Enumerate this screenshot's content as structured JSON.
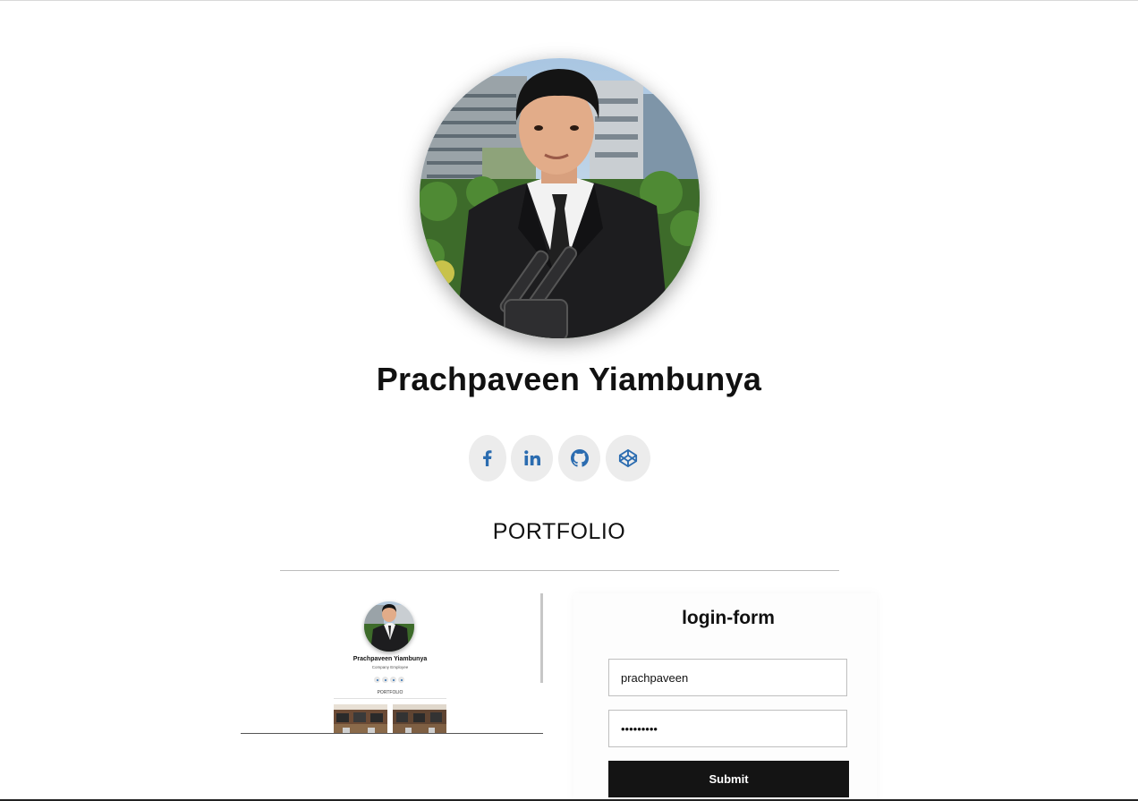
{
  "profile": {
    "name": "Prachpaveen Yiambunya",
    "photo_alt": "profile photo"
  },
  "socials": [
    {
      "network": "facebook",
      "icon": "facebook-icon"
    },
    {
      "network": "linkedin",
      "icon": "linkedin-icon"
    },
    {
      "network": "github",
      "icon": "github-icon"
    },
    {
      "network": "codepen",
      "icon": "codepen-icon"
    }
  ],
  "colors": {
    "icon_accent": "#2b6cb0",
    "social_bg": "#ececec",
    "button_bg": "#141414"
  },
  "section": {
    "title": "PORTFOLIO"
  },
  "preview": {
    "name": "Prachpaveen Yiambunya",
    "subtitle": "Company Employee",
    "section_title": "PORTFOLIO"
  },
  "login": {
    "title": "login-form",
    "username_value": "prachpaveen",
    "password_value": "prachpave",
    "submit_label": "Submit"
  }
}
